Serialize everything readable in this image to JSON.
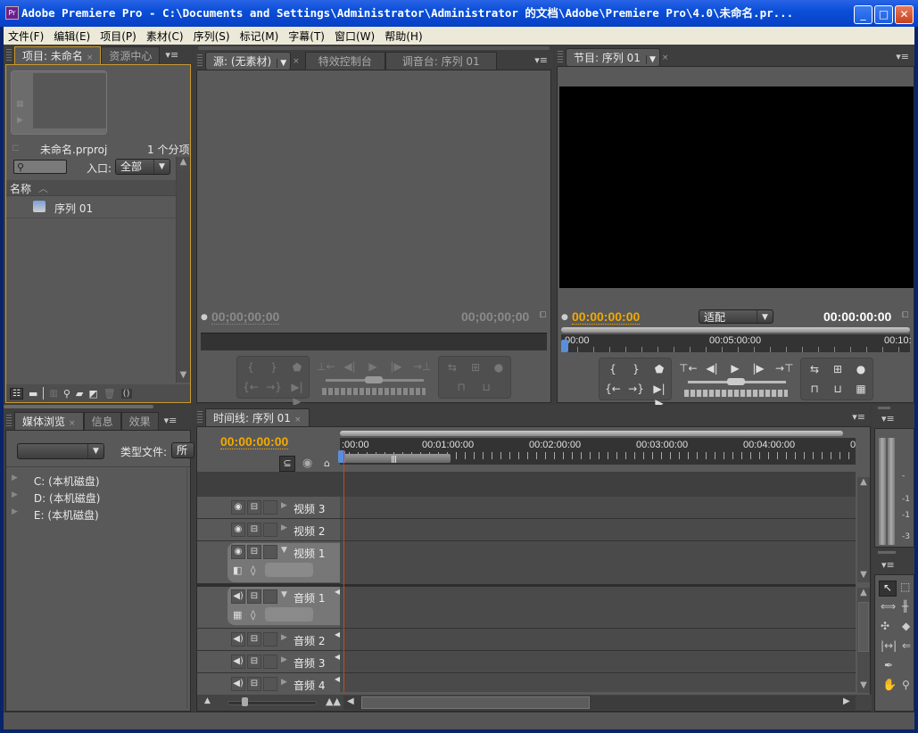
{
  "window": {
    "title": "Adobe Premiere Pro - C:\\Documents and Settings\\Administrator\\Administrator 的文档\\Adobe\\Premiere Pro\\4.0\\未命名.pr...",
    "app_icon": "Pr",
    "minimize": "_",
    "maximize": "□",
    "close": "✕"
  },
  "menu": [
    "文件(F)",
    "编辑(E)",
    "项目(P)",
    "素材(C)",
    "序列(S)",
    "标记(M)",
    "字幕(T)",
    "窗口(W)",
    "帮助(H)"
  ],
  "project_panel": {
    "tabs": [
      {
        "label": "项目: 未命名",
        "active": true,
        "closable": true
      },
      {
        "label": "资源中心",
        "active": false
      }
    ],
    "menu_icon": "▾≡",
    "project_file": "未命名.prproj",
    "item_count": "1 个分项",
    "search_placeholder": "",
    "in_label": "入口:",
    "in_value": "全部",
    "column_name": "名称",
    "sort_icon": "︿",
    "items": [
      {
        "name": "序列 01",
        "icon": "sequence-icon"
      }
    ],
    "bottom_icons": [
      "list-view-icon",
      "icon-view-icon",
      "automate-icon",
      "find-icon",
      "new-bin-icon",
      "new-item-icon",
      "clear-icon"
    ]
  },
  "media_panel": {
    "tabs": [
      {
        "label": "媒体浏览",
        "active": true,
        "closable": true
      },
      {
        "label": "信息",
        "active": false
      },
      {
        "label": "效果",
        "active": false
      }
    ],
    "menu_icon": "▾≡",
    "dropdown_value": "",
    "type_label": "类型文件:",
    "type_value": "所有",
    "drives": [
      "C: (本机磁盘)",
      "D: (本机磁盘)",
      "E: (本机磁盘)"
    ]
  },
  "source_panel": {
    "tabs": [
      {
        "label": "源: (无素材)",
        "active": true,
        "dropdown": true,
        "closable": true
      },
      {
        "label": "特效控制台",
        "active": false
      },
      {
        "label": "调音台: 序列 01",
        "active": false
      }
    ],
    "menu_icon": "▾≡",
    "timecode_left": "00;00;00;00",
    "timecode_right": "00;00;00;00"
  },
  "program_panel": {
    "tab": "节目: 序列 01",
    "menu_icon": "▾≡",
    "timecode_left": "00:00:00:00",
    "fit_value": "适配",
    "timecode_right": "00:00:00:00",
    "ruler": [
      "00:00",
      "00:05:00:00",
      "00:10:"
    ]
  },
  "timeline_panel": {
    "tab": "时间线: 序列 01",
    "menu_icon": "▾≡",
    "timecode": "00:00:00:00",
    "ruler": [
      ":00:00",
      "00:01:00:00",
      "00:02:00:00",
      "00:03:00:00",
      "00:04:00:00",
      "0"
    ],
    "video_tracks": [
      {
        "name": "视频 3",
        "expanded": false
      },
      {
        "name": "视频 2",
        "expanded": false
      },
      {
        "name": "视频 1",
        "expanded": true
      }
    ],
    "audio_tracks": [
      {
        "name": "音频 1",
        "expanded": true
      },
      {
        "name": "音频 2",
        "expanded": false
      },
      {
        "name": "音频 3",
        "expanded": false
      },
      {
        "name": "音频 4",
        "expanded": false
      }
    ]
  },
  "audio_meter": {
    "menu_icon": "▾≡",
    "labels": [
      "-",
      "-1",
      "-1",
      "-3"
    ]
  },
  "tools_panel": {
    "menu_icon": "▾≡",
    "tools": [
      "selection-tool",
      "track-select-tool",
      "ripple-edit-tool",
      "rolling-edit-tool",
      "rate-stretch-tool",
      "razor-tool",
      "slip-tool",
      "slide-tool",
      "pen-tool",
      "hand-tool",
      "zoom-tool"
    ]
  },
  "colors": {
    "accent_timecode": "#f2a900",
    "playhead": "#d0402a",
    "panel_bg": "#595959",
    "titlebar": "#0a4fd8"
  }
}
